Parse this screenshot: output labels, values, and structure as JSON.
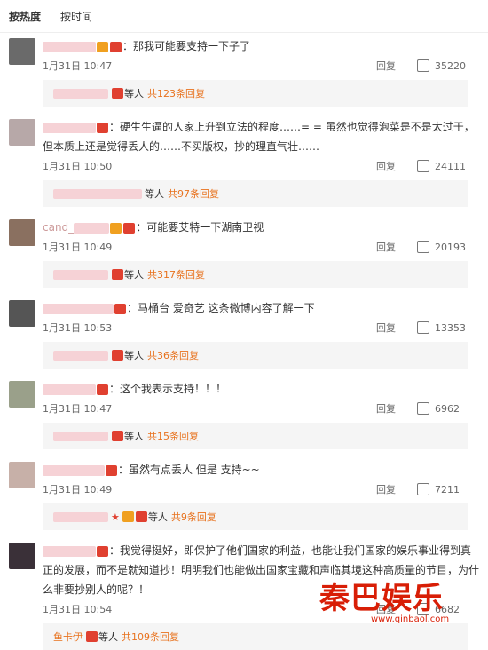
{
  "tabs": [
    {
      "label": "按热度",
      "active": true
    },
    {
      "label": "按时间",
      "active": false
    }
  ],
  "comments": [
    {
      "text": "：那我可能要支持一下子了",
      "time": "1月31日 10:47",
      "reply_label": "回复",
      "likes": "35220",
      "sub_suffix": "等人",
      "sub_count": "共123条回复"
    },
    {
      "text": "：硬生生逼的人家上升到立法的程度……= = 虽然也觉得泡菜是不是太过于，但本质上还是觉得丢人的……不买版权，抄的理直气壮……",
      "time": "1月31日 10:50",
      "reply_label": "回复",
      "likes": "24111",
      "sub_suffix": "等人",
      "sub_count": "共97条回复"
    },
    {
      "user_fragment": "cand_",
      "text": "：可能要艾特一下湖南卫视",
      "time": "1月31日 10:49",
      "reply_label": "回复",
      "likes": "20193",
      "sub_suffix": "等人",
      "sub_count": "共317条回复"
    },
    {
      "text": "：马桶台 爱奇艺 这条微博内容了解一下",
      "time": "1月31日 10:53",
      "reply_label": "回复",
      "likes": "13353",
      "sub_suffix": "等人",
      "sub_count": "共36条回复"
    },
    {
      "text": "：这个我表示支持！！！",
      "time": "1月31日 10:47",
      "reply_label": "回复",
      "likes": "6962",
      "sub_suffix": "等人",
      "sub_count": "共15条回复"
    },
    {
      "text": "：虽然有点丢人 但是 支持~~",
      "time": "1月31日 10:49",
      "reply_label": "回复",
      "likes": "7211",
      "sub_suffix": "等人",
      "sub_count": "共9条回复"
    },
    {
      "text": "：我觉得挺好，即保护了他们国家的利益，也能让我们国家的娱乐事业得到真正的发展，而不是就知道抄！明明我们也能做出国家宝藏和声临其境这种高质量的节目，为什么非要抄别人的呢？！",
      "time": "1月31日 10:54",
      "reply_label": "回复",
      "likes": "6682",
      "sub_user": "鱼卡伊",
      "sub_suffix": "等人",
      "sub_count": "共109条回复"
    }
  ],
  "watermark": {
    "text": "秦巴娱乐",
    "url": "www.qinbaol.com"
  }
}
